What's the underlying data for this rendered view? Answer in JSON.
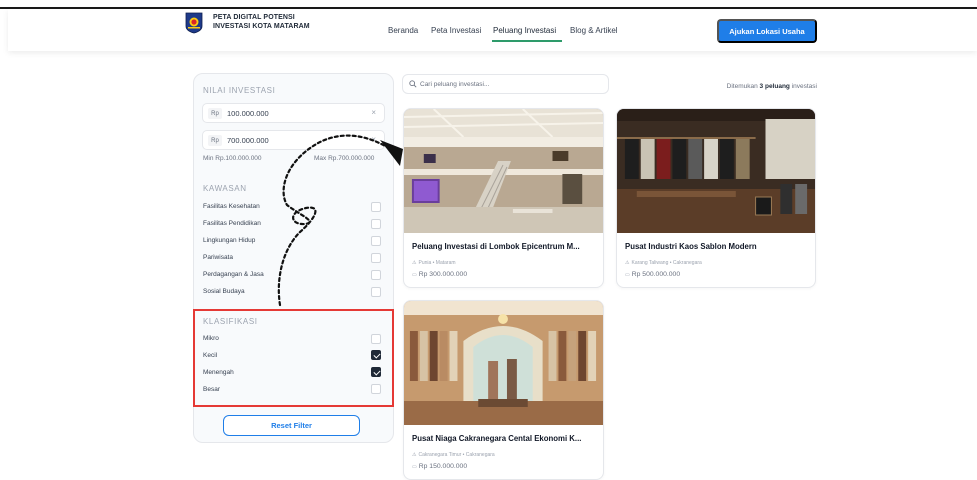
{
  "header": {
    "brand_line1": "PETA DIGITAL POTENSI",
    "brand_line2": "INVESTASI KOTA MATARAM",
    "nav": [
      "Beranda",
      "Peta Investasi",
      "Peluang Investasi",
      "Blog & Artikel"
    ],
    "active_nav": "Peluang Investasi",
    "cta_label": "Ajukan Lokasi Usaha",
    "accent": "#1f7ee8",
    "active_underline": "#2e9b6b"
  },
  "sidebar": {
    "investment": {
      "title": "NILAI INVESTASI",
      "currency": "Rp",
      "min_value": "100.000.000",
      "max_value": "700.000.000",
      "clear_icon": "×",
      "min_label": "Min Rp.100.000.000",
      "max_label": "Max Rp.700.000.000"
    },
    "kawasan": {
      "title": "KAWASAN",
      "options": [
        {
          "label": "Fasilitas Kesehatan",
          "checked": false
        },
        {
          "label": "Fasilitas Pendidikan",
          "checked": false
        },
        {
          "label": "Lingkungan Hidup",
          "checked": false
        },
        {
          "label": "Pariwisata",
          "checked": false
        },
        {
          "label": "Perdagangan & Jasa",
          "checked": false
        },
        {
          "label": "Sosial Budaya",
          "checked": false
        }
      ]
    },
    "klasifikasi": {
      "title": "KLASIFIKASI",
      "options": [
        {
          "label": "Mikro",
          "checked": false
        },
        {
          "label": "Kecil",
          "checked": true
        },
        {
          "label": "Menengah",
          "checked": true
        },
        {
          "label": "Besar",
          "checked": false
        }
      ]
    },
    "reset_label": "Reset Filter",
    "highlight_color": "#e53935"
  },
  "main": {
    "search_placeholder": "Cari peluang investasi...",
    "found_prefix": "Ditemukan",
    "found_count": "3 peluang",
    "found_suffix": "investasi",
    "cards": [
      {
        "title": "Peluang Investasi di Lombok Epicentrum M...",
        "location": "Punia • Mataram",
        "price": "Rp 300.000.000"
      },
      {
        "title": "Pusat Industri Kaos Sablon Modern",
        "location": "Karang Taliwang • Cakranegara",
        "price": "Rp 500.000.000"
      },
      {
        "title": "Pusat Niaga Cakranegara Cental Ekonomi K...",
        "location": "Cakranegara Timur • Cakranegara",
        "price": "Rp 150.000.000"
      }
    ]
  }
}
